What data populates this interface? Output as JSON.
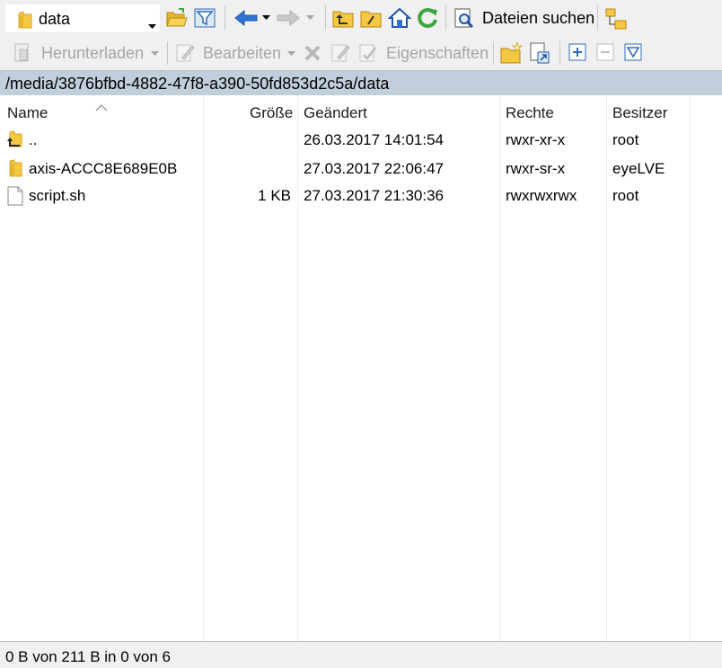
{
  "toolbar": {
    "location_value": "data",
    "search_label": "Dateien suchen"
  },
  "toolbar2": {
    "download_label": "Herunterladen",
    "edit_label": "Bearbeiten",
    "properties_label": "Eigenschaften"
  },
  "path": "/media/3876bfbd-4882-47f8-a390-50fd853d2c5a/data",
  "columns": {
    "name": "Name",
    "size": "Größe",
    "modified": "Geändert",
    "rights": "Rechte",
    "owner": "Besitzer"
  },
  "files": [
    {
      "name": "..",
      "size": "",
      "modified": "26.03.2017 14:01:54",
      "rights": "rwxr-xr-x",
      "owner": "root",
      "icon": "parent-folder-icon"
    },
    {
      "name": "axis-ACCC8E689E0B",
      "size": "",
      "modified": "27.03.2017 22:06:47",
      "rights": "rwxr-sr-x",
      "owner": "eyeLVE",
      "icon": "folder-icon"
    },
    {
      "name": "script.sh",
      "size": "1 KB",
      "modified": "27.03.2017 21:30:36",
      "rights": "rwxrwxrwx",
      "owner": "root",
      "icon": "file-icon"
    }
  ],
  "status": "0 B von 211 B in 0 von 6",
  "colors": {
    "pathbar_bg": "#c1cfdd",
    "toolbar_bg": "#f0f0f0",
    "folder_yellow": "#f5c842",
    "arrow_blue": "#2e74d6",
    "refresh_green": "#3aa53a"
  }
}
